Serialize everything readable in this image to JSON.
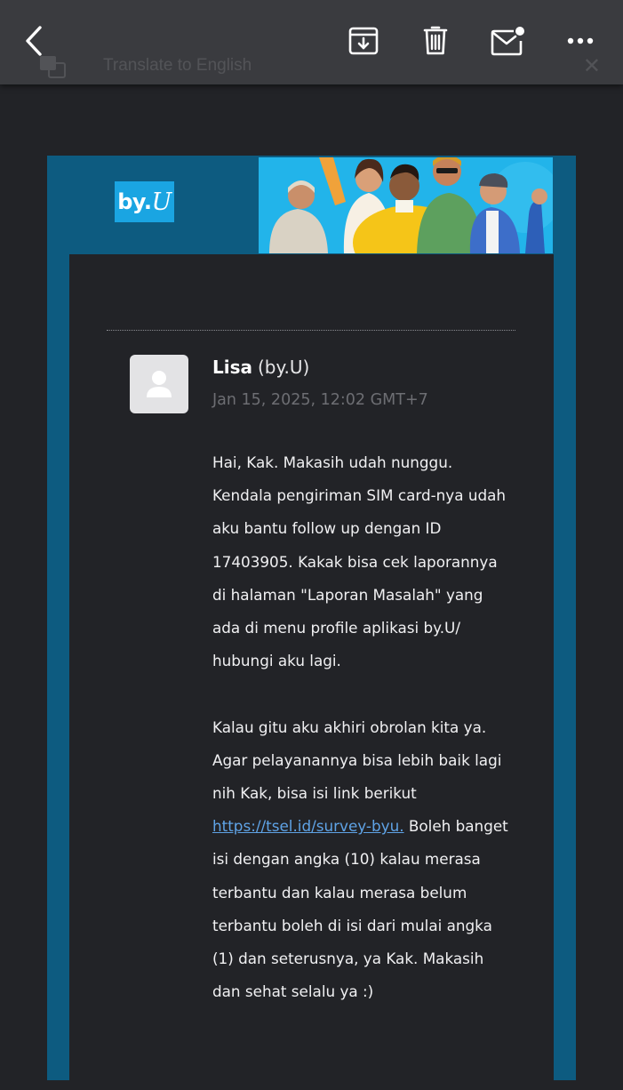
{
  "toolbar": {
    "translate_label": "Translate to English",
    "icons": [
      "back-icon",
      "archive-icon",
      "delete-icon",
      "mark-unread-icon",
      "more-icon"
    ]
  },
  "brand": {
    "logo_prefix": "by.",
    "logo_suffix": "U",
    "logo_color": "#1aa5e2",
    "frame_color": "#0d5b80"
  },
  "email": {
    "sender_name": "Lisa",
    "sender_org": "(by.U)",
    "timestamp": "Jan 15, 2025, 12:02 GMT+7",
    "body": {
      "p1_lines": [
        "Hai, Kak. Makasih udah nunggu.",
        "Kendala pengiriman SIM card-nya udah",
        "aku bantu follow up dengan ID",
        "17403905. Kakak bisa cek laporannya",
        "di halaman \"Laporan Masalah\" yang",
        "ada di menu profile aplikasi by.U/",
        "hubungi aku lagi."
      ],
      "p2_lines": [
        "Kalau gitu aku akhiri obrolan kita ya.",
        "Agar pelayanannya bisa lebih baik lagi",
        "nih Kak, bisa isi link berikut"
      ],
      "link_text": "https://tsel.id/survey-byu.",
      "after_link": " Boleh banget",
      "p2_rest_lines": [
        "isi dengan angka (10) kalau merasa",
        "terbantu dan kalau merasa belum",
        "terbantu boleh di isi dari mulai angka",
        "(1) dan seterusnya, ya Kak. Makasih",
        "dan sehat selalu ya :)"
      ]
    },
    "link_color": "#5fa3e6"
  }
}
